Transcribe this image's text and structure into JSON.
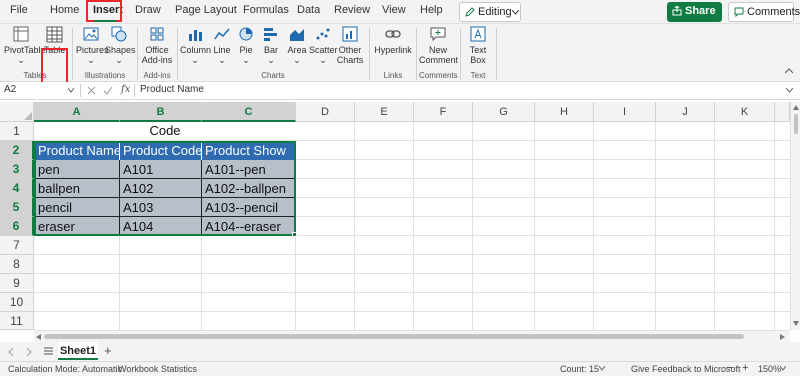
{
  "menu": {
    "tabs": [
      "File",
      "Home",
      "Insert",
      "Draw",
      "Page Layout",
      "Formulas",
      "Data",
      "Review",
      "View",
      "Help"
    ],
    "editing_label": "Editing",
    "share_label": "Share",
    "comments_label": "Comments"
  },
  "ribbon": {
    "items": {
      "pivottable": "PivotTable",
      "table": "Table",
      "pictures": "Pictures",
      "shapes": "Shapes",
      "office_addins_1": "Office",
      "office_addins_2": "Add-ins",
      "column": "Column",
      "line": "Line",
      "pie": "Pie",
      "bar": "Bar",
      "area": "Area",
      "scatter": "Scatter",
      "other_charts_1": "Other",
      "other_charts_2": "Charts",
      "hyperlink": "Hyperlink",
      "new_comment_1": "New",
      "new_comment_2": "Comment",
      "text_box_1": "Text",
      "text_box_2": "Box"
    },
    "groups": {
      "tables": "Tables",
      "illustrations": "Illustrations",
      "addins": "Add-ins",
      "charts": "Charts",
      "links": "Links",
      "comments": "Comments",
      "text": "Text"
    }
  },
  "formula_bar": {
    "name_box": "A2",
    "fx": "fx",
    "formula": "Product Name"
  },
  "grid": {
    "columns": [
      "A",
      "B",
      "C",
      "D",
      "E",
      "F",
      "G",
      "H",
      "I",
      "J",
      "K"
    ],
    "rows": [
      "1",
      "2",
      "3",
      "4",
      "5",
      "6",
      "7",
      "8",
      "9",
      "10",
      "11"
    ],
    "title_cell": "Code",
    "headers": [
      "Product Name",
      "Product Code",
      "Product Show"
    ],
    "data": [
      [
        "pen",
        "A101",
        "A101--pen"
      ],
      [
        "ballpen",
        "A102",
        "A102--ballpen"
      ],
      [
        "pencil",
        "A103",
        "A103--pencil"
      ],
      [
        "eraser",
        "A104",
        "A104--eraser"
      ]
    ]
  },
  "sheets": {
    "active": "Sheet1",
    "add": "+"
  },
  "status": {
    "calc_mode": "Calculation Mode: Automatic",
    "workbook_stats": "Workbook Statistics",
    "count": "Count: 15",
    "feedback": "Give Feedback to Microsoft",
    "zoom": "150%"
  },
  "colors": {
    "accent": "#107c41",
    "table_header": "#2e6bb0",
    "table_body": "#b7bfc9",
    "highlight": "#e8262b"
  }
}
